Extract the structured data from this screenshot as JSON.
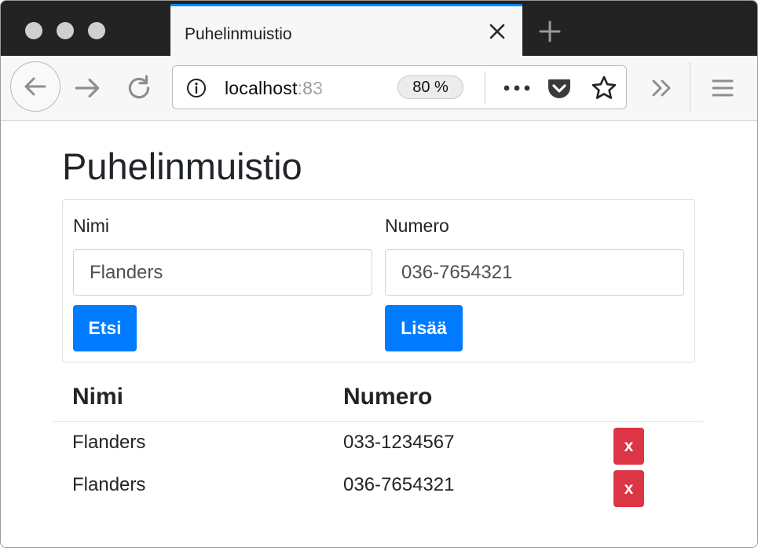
{
  "browser": {
    "tab_title": "Puhelinmuistio",
    "url_host": "localhost",
    "url_port_fragment": ":83",
    "zoom_level": "80 %"
  },
  "page": {
    "title": "Puhelinmuistio",
    "search": {
      "label": "Nimi",
      "value": "Flanders",
      "button_label": "Etsi"
    },
    "add": {
      "label": "Numero",
      "value": "036-7654321",
      "button_label": "Lisää"
    },
    "table": {
      "headers": [
        "Nimi",
        "Numero"
      ],
      "rows": [
        {
          "name": "Flanders",
          "number": "033-1234567",
          "delete_label": "x"
        },
        {
          "name": "Flanders",
          "number": "036-7654321",
          "delete_label": "x"
        }
      ]
    }
  },
  "colors": {
    "primary": "#007bff",
    "danger": "#dc3545",
    "tab_accent": "#0a84ff"
  }
}
